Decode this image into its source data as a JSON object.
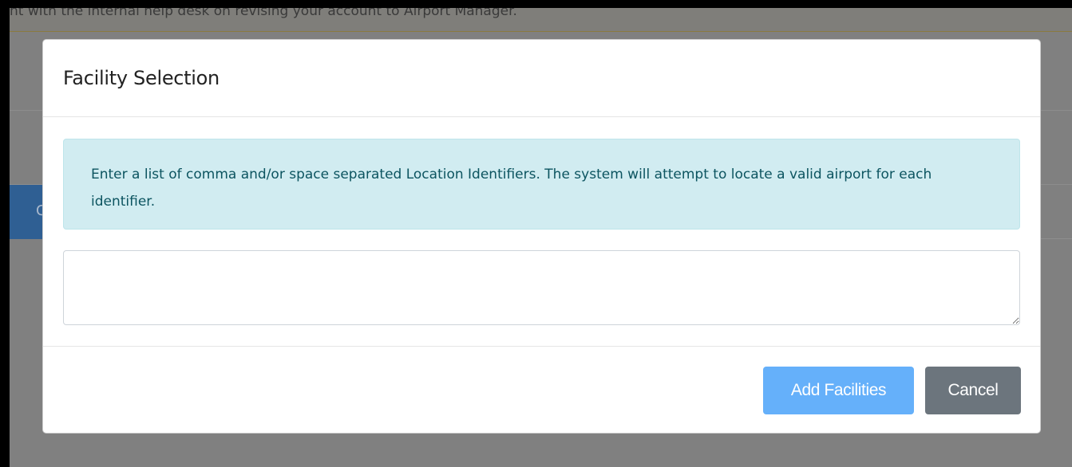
{
  "background": {
    "banner_text": "nt with the internal help desk on revising your account to Airport Manager.",
    "blue_button_label": "C"
  },
  "modal": {
    "title": "Facility Selection",
    "info_text": "Enter a list of comma and/or space separated Location Identifiers. The system will attempt to locate a valid airport for each identifier.",
    "textarea_value": "",
    "buttons": {
      "add_label": "Add Facilities",
      "cancel_label": "Cancel"
    }
  },
  "colors": {
    "primary": "#65b0fa",
    "secondary": "#6c757d",
    "info_bg": "#d1ecf1",
    "info_text": "#0c5460"
  }
}
